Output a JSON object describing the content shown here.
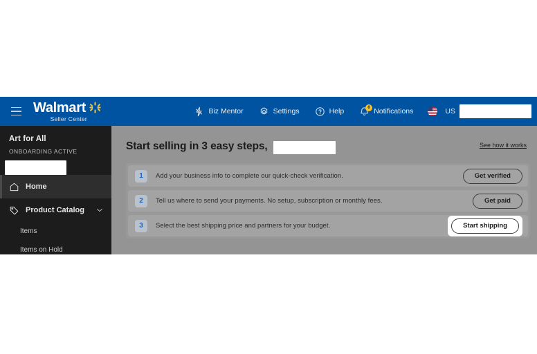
{
  "topnav": {
    "menu_icon": "hamburger-icon",
    "brand": "Walmart",
    "brand_sub": "Seller Center",
    "items": [
      {
        "label": "Biz Mentor",
        "icon": "lightning-bolt-icon"
      },
      {
        "label": "Settings",
        "icon": "gear-icon"
      },
      {
        "label": "Help",
        "icon": "question-circle-icon"
      },
      {
        "label": "Notifications",
        "icon": "bell-icon",
        "badge": "0"
      }
    ],
    "country": "US",
    "country_icon": "us-flag-icon",
    "user_redacted": ""
  },
  "sidebar": {
    "account_name": "Art for All",
    "account_status": "ONBOARDING ACTIVE",
    "account_redacted": "",
    "items": [
      {
        "label": "Home",
        "icon": "home-icon",
        "active": true
      },
      {
        "label": "Product Catalog",
        "icon": "tag-icon",
        "active": false,
        "expandable": true
      }
    ],
    "sub_items": [
      {
        "label": "Items"
      },
      {
        "label": "Items on Hold"
      }
    ]
  },
  "main": {
    "title": "Start selling in 3 easy steps,",
    "title_redacted": "",
    "see_how_link": "See how it works",
    "steps": [
      {
        "number": "1",
        "text": "Add your business info to complete our quick-check verification.",
        "button": "Get verified",
        "focused": false
      },
      {
        "number": "2",
        "text": "Tell us where to send your payments. No setup, subscription or monthly fees.",
        "button": "Get paid",
        "focused": false
      },
      {
        "number": "3",
        "text": "Select the best shipping price and partners for your budget.",
        "button": "Start shipping",
        "focused": true
      }
    ]
  },
  "colors": {
    "nav_blue": "#0053a0",
    "spark_yellow": "#ffc220",
    "sidebar_dark": "#1c1c1c",
    "content_gray": "#949494",
    "step_num_blue": "#1668c1",
    "badge_yellow": "#ffc220"
  }
}
